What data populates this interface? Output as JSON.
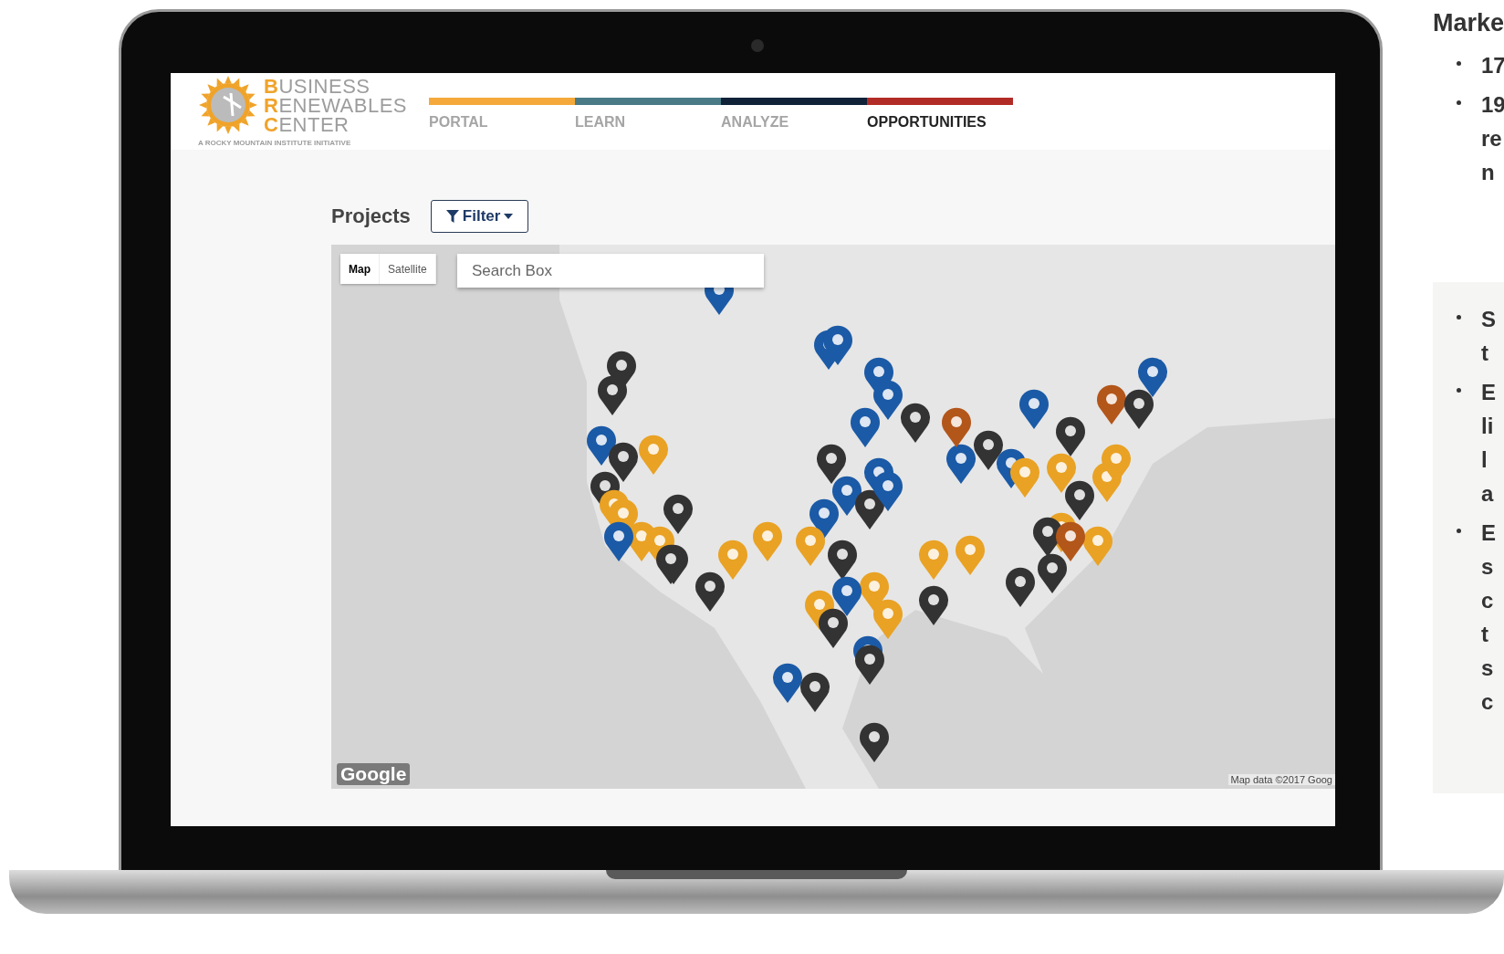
{
  "site": {
    "logo_words": [
      "BUSINESS",
      "RENEWABLES",
      "CENTER"
    ],
    "tagline": "A ROCKY MOUNTAIN INSTITUTE INITIATIVE"
  },
  "nav": [
    {
      "label": "PORTAL",
      "color": "#f4a93a",
      "selected": false
    },
    {
      "label": "LEARN",
      "color": "#4a7a86",
      "selected": false
    },
    {
      "label": "ANALYZE",
      "color": "#0f2238",
      "selected": false
    },
    {
      "label": "OPPORTUNITIES",
      "color": "#b22c27",
      "selected": true
    }
  ],
  "projects": {
    "title": "Projects",
    "filter_button": "Filter"
  },
  "map": {
    "types": [
      {
        "label": "Map",
        "selected": true
      },
      {
        "label": "Satellite",
        "selected": false
      }
    ],
    "search": {
      "placeholder": "Search Box"
    },
    "logo": "Google",
    "attribution": "Map data ©2017 Goog"
  },
  "side": {
    "heading": "Marke",
    "bullets": [
      [
        "17"
      ],
      [
        "19",
        "re",
        "n"
      ]
    ],
    "panel_bullets": [
      [
        "S",
        "t"
      ],
      [
        "E",
        "li",
        "l",
        "a"
      ],
      [
        "E",
        "s",
        "c",
        "t",
        "s",
        "c"
      ]
    ]
  }
}
